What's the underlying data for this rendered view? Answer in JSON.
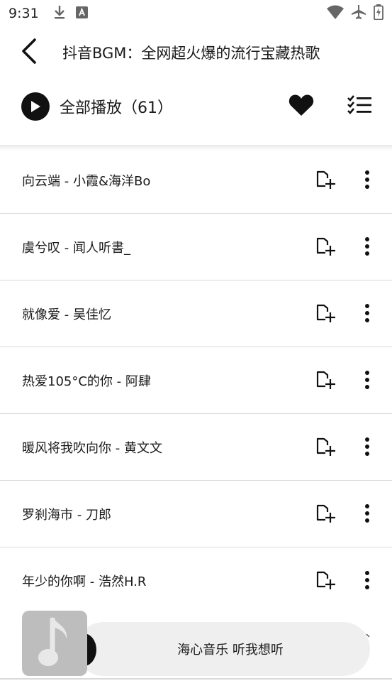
{
  "status_bar": {
    "time": "9:31",
    "left_icons": [
      "download-icon",
      "app-notification-icon"
    ],
    "right_icons": [
      "wifi-icon",
      "airplane-mode-icon",
      "battery-charging-icon"
    ]
  },
  "header": {
    "back_icon": "back-arrow-icon",
    "title": "抖音BGM：全网超火爆的流行宝藏热歌"
  },
  "play_all": {
    "label": "全部播放（61）",
    "play_icon": "play-icon",
    "favorite_icon": "heart-icon",
    "list_icon": "checklist-icon"
  },
  "songs": [
    {
      "title": "向云端 - 小霞&海洋Bo"
    },
    {
      "title": "虞兮叹 - 闻人听書_"
    },
    {
      "title": "就像爱 - 吴佳忆"
    },
    {
      "title": "热爱105°C的你 - 阿肆"
    },
    {
      "title": "暖风将我吹向你 - 黄文文"
    },
    {
      "title": "罗刹海市 - 刀郎"
    },
    {
      "title": "年少的你啊 - 浩然H.R"
    }
  ],
  "row_icons": {
    "add": "add-to-playlist-icon",
    "more": "more-vertical-icon"
  },
  "player": {
    "text": "海心音乐 听我想听",
    "cover_icon": "music-note-icon"
  },
  "colors": {
    "text": "#1a1a1a",
    "divider": "#d9d9d9",
    "player_pill": "#efefef",
    "cover": "#bdbdbd"
  }
}
